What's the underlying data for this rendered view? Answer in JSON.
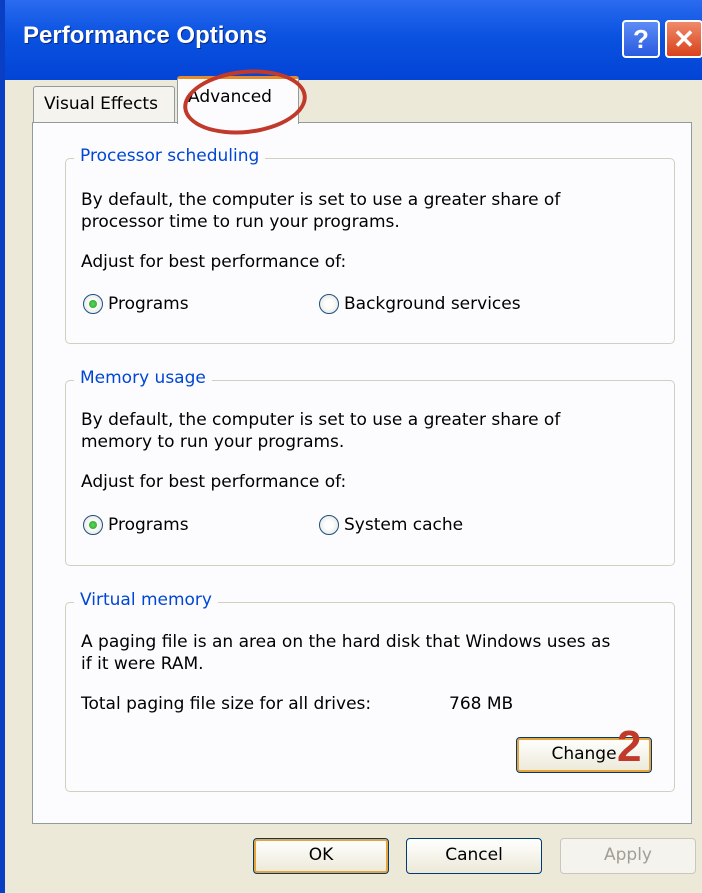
{
  "window": {
    "title": "Performance Options",
    "help_glyph": "?",
    "close_glyph": "✕"
  },
  "tabs": [
    {
      "label": "Visual Effects",
      "selected": false
    },
    {
      "label": "Advanced",
      "selected": true
    }
  ],
  "processor": {
    "legend": "Processor scheduling",
    "desc_line1": "By default, the computer is set to use a greater share of",
    "desc_line2": "processor time to run your programs.",
    "adjust_label": "Adjust for best performance of:",
    "option_programs": "Programs",
    "option_background": "Background services",
    "selected": "Programs"
  },
  "memory": {
    "legend": "Memory usage",
    "desc_line1": "By default, the computer is set to use a greater share of",
    "desc_line2": "memory to run your programs.",
    "adjust_label": "Adjust for best performance of:",
    "option_programs": "Programs",
    "option_cache": "System cache",
    "selected": "Programs"
  },
  "virtual": {
    "legend": "Virtual memory",
    "desc_line1": "A paging file is an area on the hard disk that Windows uses as",
    "desc_line2": "if it were RAM.",
    "total_label": "Total paging file size for all drives:",
    "total_value": "768 MB",
    "change_label": "Change"
  },
  "footer": {
    "ok_label": "OK",
    "cancel_label": "Cancel",
    "apply_label": "Apply"
  },
  "annotations": {
    "step_two": "2"
  },
  "colors": {
    "titlebar": "#0a52e0",
    "legend_text": "#0046d5",
    "annotation_red": "#c0392b",
    "radio_selected": "#21a121"
  }
}
